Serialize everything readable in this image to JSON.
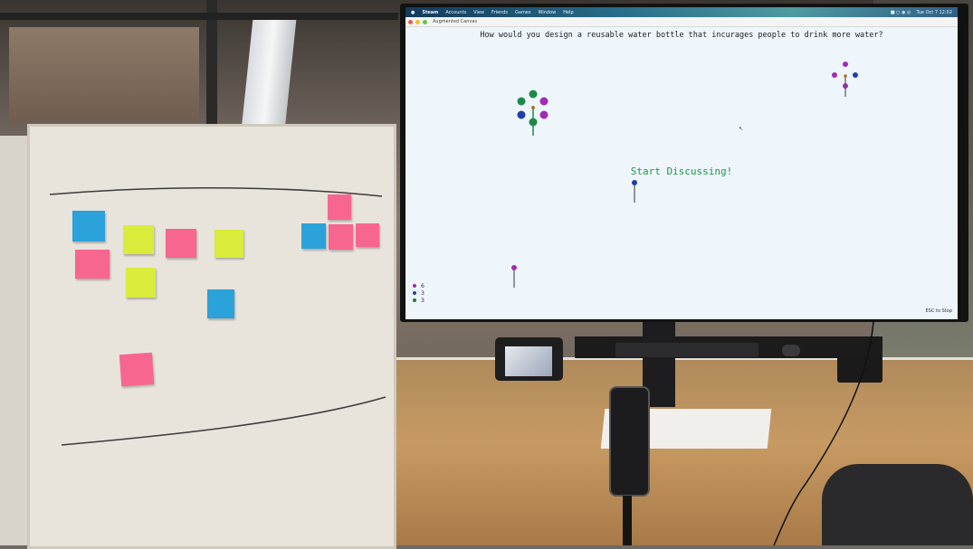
{
  "tv": {
    "menubar": {
      "app_name": "Steam",
      "items": [
        "Accounts",
        "View",
        "Friends",
        "Games",
        "Window",
        "Help"
      ],
      "clock": "Tue Oct 7 12:02"
    },
    "window_title": "Augmented Canvas",
    "question": "How would you design a reusable water bottle that incurages people to drink more water?",
    "status": "Start Discussing!",
    "legend": [
      {
        "count": "6",
        "color": "#9b2aa8"
      },
      {
        "count": "3",
        "color": "#1f3fa8"
      },
      {
        "count": "3",
        "color": "#1d7a45"
      }
    ],
    "esc_hint": "ESC to Stop"
  },
  "colors": {
    "purple": "#a12bb5",
    "blue": "#1f3fa8",
    "green": "#1d8a48",
    "status_green": "#1b9a3f",
    "note_pink": "#f35a86",
    "note_yellow": "#d8ec3a",
    "note_blue": "#2aa0d8"
  },
  "icons": [
    "apple-icon",
    "close-dot-icon",
    "minimize-dot-icon",
    "maximize-dot-icon"
  ]
}
